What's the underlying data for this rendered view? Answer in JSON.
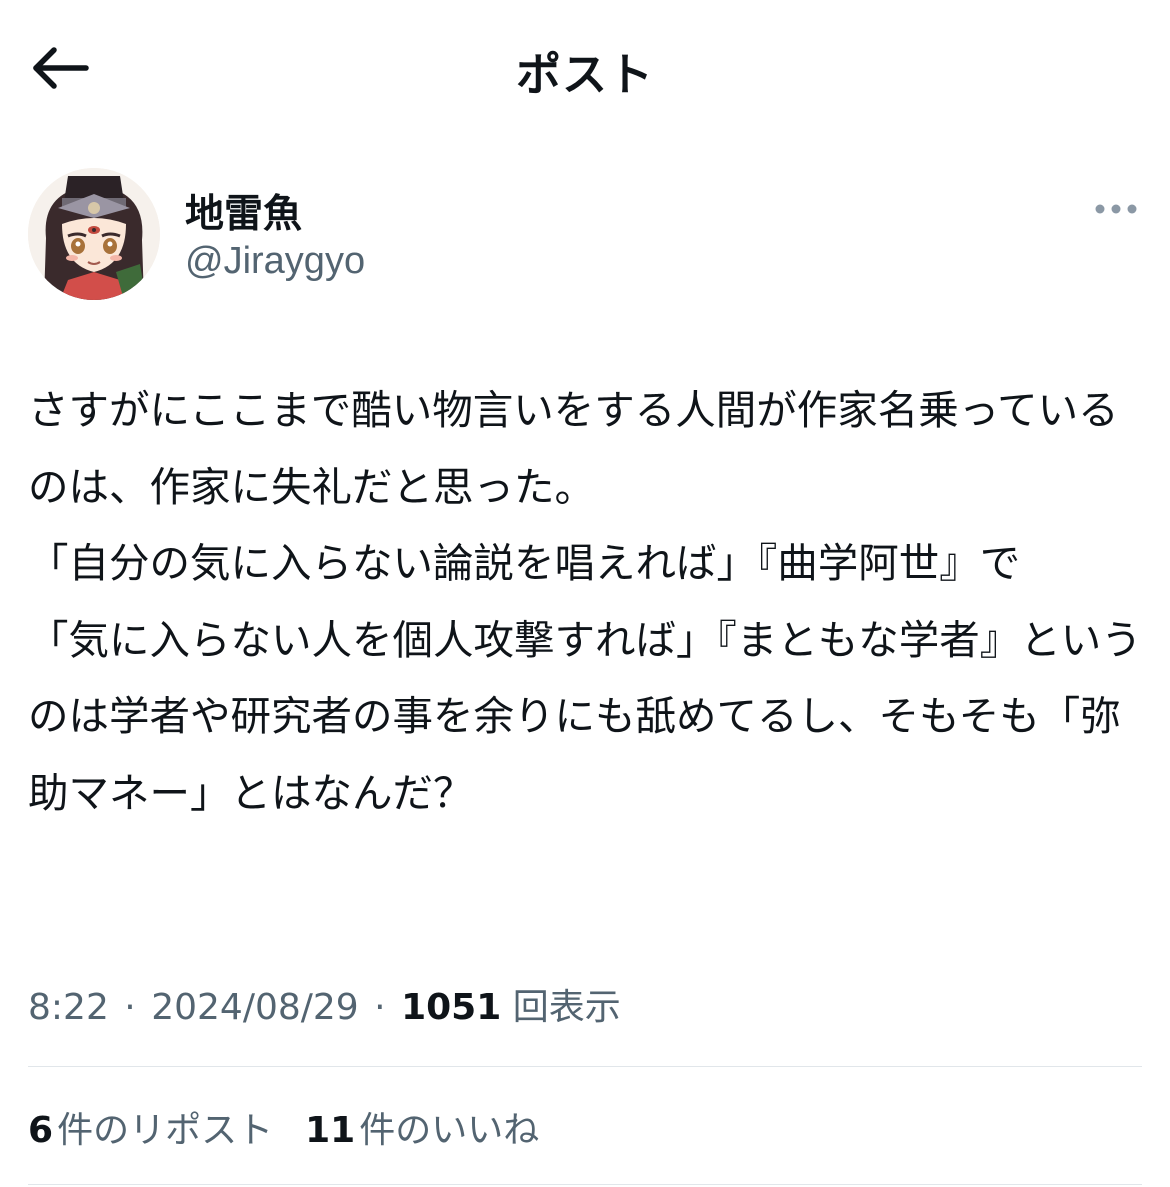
{
  "header": {
    "title": "ポスト",
    "back_icon": "arrow-left-icon"
  },
  "author": {
    "display_name": "地雷魚",
    "handle": "@Jiraygyo",
    "more_icon": "more-horizontal-icon"
  },
  "post": {
    "text": "さすがにここまで酷い物言いをする人間が作家名乗っているのは、作家に失礼だと思った。\n「自分の気に入らない論説を唱えれば」『曲学阿世』で\n「気に入らない人を個人攻撃すれば」『まともな学者』というのは学者や研究者の事を余りにも舐めてるし、そもそも「弥助マネー」とはなんだ？"
  },
  "meta": {
    "time": "8:22",
    "separator": "·",
    "date": "2024/08/29",
    "views_count": "1051",
    "views_label": "回表示"
  },
  "stats": {
    "reposts_count": "6",
    "reposts_label": "件のリポスト",
    "likes_count": "11",
    "likes_label": "件のいいね"
  },
  "colors": {
    "text_primary": "#0f1419",
    "text_secondary": "#536471",
    "divider": "#e1e6ea"
  }
}
